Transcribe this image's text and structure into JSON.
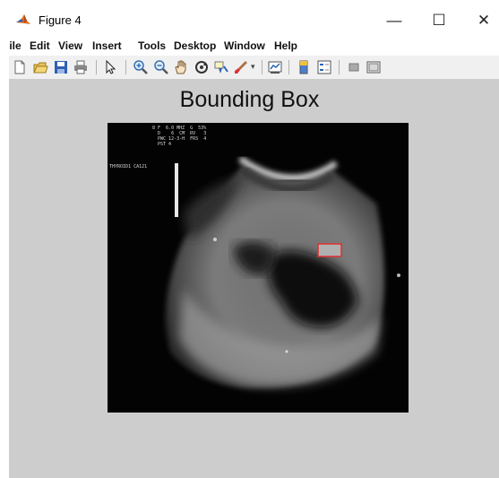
{
  "window": {
    "title": "Figure 4",
    "controls": {
      "minimize": "—",
      "maximize": "☐",
      "close": "✕"
    }
  },
  "menu": {
    "items": [
      "File",
      "Edit",
      "View",
      "Insert",
      "Tools",
      "Desktop",
      "Window",
      "Help"
    ]
  },
  "toolbar": {
    "tools": [
      "new-figure-icon",
      "open-file-icon",
      "save-icon",
      "print-icon",
      "pointer-icon",
      "zoom-in-icon",
      "zoom-out-icon",
      "pan-icon",
      "rotate-3d-icon",
      "data-cursor-icon",
      "brush-icon",
      "brush-dropdown-icon",
      "link-plot-icon",
      "colorbar-icon",
      "legend-icon",
      "hide-plot-tools-icon",
      "show-plot-tools-icon"
    ]
  },
  "figure": {
    "title": "Bounding Box",
    "background": "#cdcdcd",
    "image": {
      "overlay_lines": [
        "8 F  6.0 MHZ  G  53%",
        "  D    6  CM  RV   3",
        "  PWC 12-3-H  FRS  4",
        "  PST 4"
      ],
      "side_label": "THYROID1 CA121",
      "bounding_box_color": "#e03030"
    }
  },
  "colors": {
    "matlab_orange": "#e36c17",
    "toolbar_bg": "#f0f0f0"
  }
}
